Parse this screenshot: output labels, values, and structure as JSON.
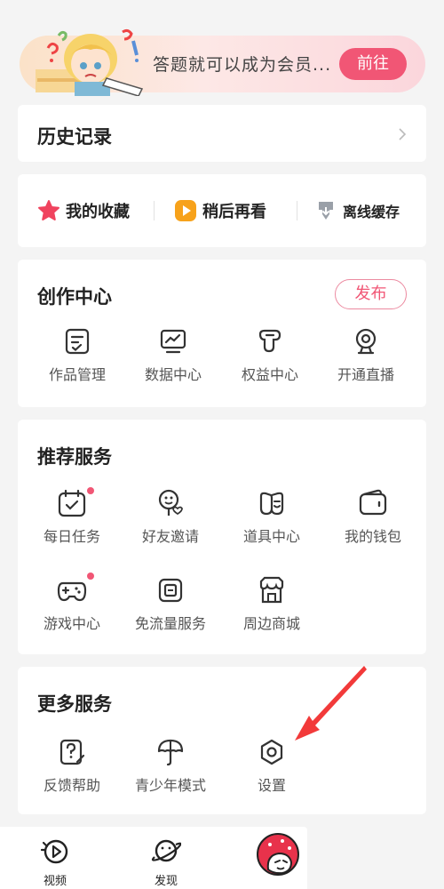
{
  "banner": {
    "text": "答题就可以成为会员...",
    "button": "前往"
  },
  "history": {
    "title": "历史记录"
  },
  "shortcuts": [
    {
      "label": "我的收藏",
      "icon": "star-icon"
    },
    {
      "label": "稍后再看",
      "icon": "play-later-icon"
    },
    {
      "label": "离线缓存",
      "icon": "download-icon"
    }
  ],
  "creation": {
    "title": "创作中心",
    "publish": "发布",
    "items": [
      {
        "label": "作品管理",
        "icon": "works-manage-icon"
      },
      {
        "label": "数据中心",
        "icon": "data-center-icon"
      },
      {
        "label": "权益中心",
        "icon": "rights-center-icon"
      },
      {
        "label": "开通直播",
        "icon": "live-camera-icon"
      }
    ]
  },
  "recommended": {
    "title": "推荐服务",
    "items": [
      {
        "label": "每日任务",
        "icon": "calendar-task-icon",
        "dot": true
      },
      {
        "label": "好友邀请",
        "icon": "invite-friend-icon",
        "dot": false
      },
      {
        "label": "道具中心",
        "icon": "mask-icon",
        "dot": false
      },
      {
        "label": "我的钱包",
        "icon": "wallet-icon",
        "dot": false
      },
      {
        "label": "游戏中心",
        "icon": "gamepad-icon",
        "dot": true
      },
      {
        "label": "免流量服务",
        "icon": "sim-card-icon",
        "dot": false
      },
      {
        "label": "周边商城",
        "icon": "store-icon",
        "dot": false
      }
    ]
  },
  "more": {
    "title": "更多服务",
    "items": [
      {
        "label": "反馈帮助",
        "icon": "feedback-help-icon"
      },
      {
        "label": "青少年模式",
        "icon": "umbrella-icon"
      },
      {
        "label": "设置",
        "icon": "settings-hexagon-icon"
      }
    ]
  },
  "bottom_nav": [
    {
      "label": "视频",
      "icon": "video-icon"
    },
    {
      "label": "发现",
      "icon": "planet-icon"
    },
    {
      "label": "",
      "icon": "mascot-avatar-icon"
    }
  ],
  "colors": {
    "accent": "#f15675",
    "background": "#f4f4f4",
    "text": "#222222",
    "label": "#555555"
  }
}
